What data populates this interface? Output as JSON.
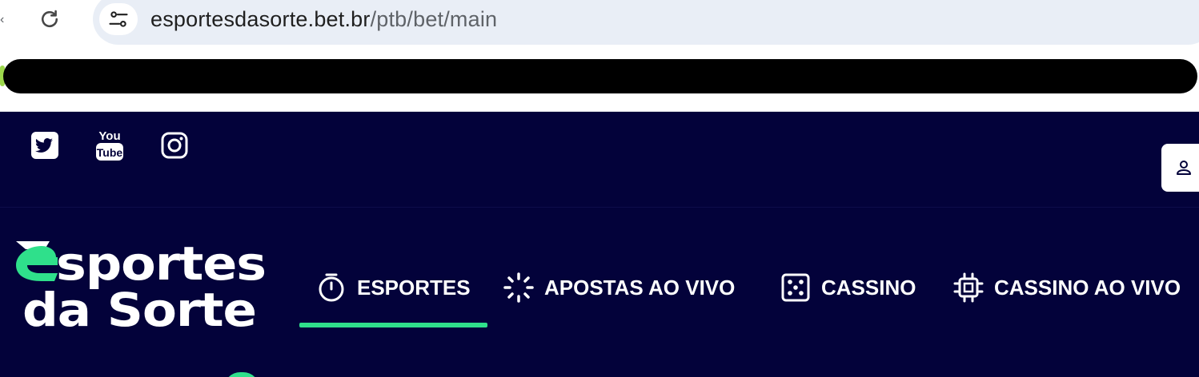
{
  "browser": {
    "url_host": "esportesdasorte.bet.br",
    "url_path": "/ptb/bet/main",
    "icons": [
      "reload-icon",
      "site-info-icon"
    ]
  },
  "site": {
    "colors": {
      "background": "#03023a",
      "accent": "#2fe08b",
      "text": "#ffffff"
    },
    "social": [
      "twitter-icon",
      "youtube-icon",
      "instagram-icon"
    ],
    "youtube_text_top": "You",
    "youtube_text_bottom": "Tube",
    "logo": {
      "line1_accent": "E",
      "line1_rest": "sportes",
      "line2": "da Sorte"
    },
    "nav": {
      "active": "ESPORTES",
      "items": [
        {
          "label": "ESPORTES",
          "icon": "stopwatch-icon"
        },
        {
          "label": "APOSTAS AO VIVO",
          "icon": "live-burst-icon"
        },
        {
          "label": "CASSINO",
          "icon": "dice-icon"
        },
        {
          "label": "CASSINO AO VIVO",
          "icon": "chip-icon"
        }
      ]
    }
  }
}
